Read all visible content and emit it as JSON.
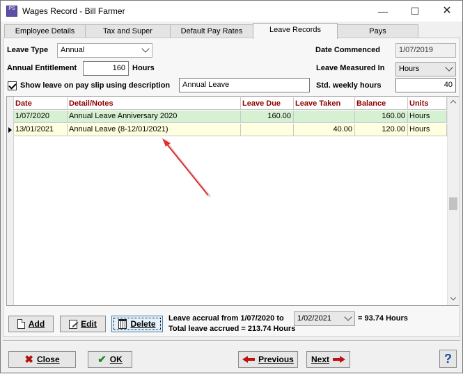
{
  "window": {
    "app_icon_text": "PS",
    "title": "Wages Record - Bill Farmer",
    "minimize": "—",
    "maximize": "☐",
    "close": "✕"
  },
  "tabs": [
    {
      "label": "Employee Details",
      "active": false
    },
    {
      "label": "Tax and Super",
      "active": false
    },
    {
      "label": "Default Pay Rates",
      "active": false
    },
    {
      "label": "Leave Records",
      "active": true
    },
    {
      "label": "Pays",
      "active": false
    }
  ],
  "form": {
    "leave_type_label": "Leave Type",
    "leave_type_value": "Annual",
    "date_commenced_label": "Date Commenced",
    "date_commenced_value": "1/07/2019",
    "annual_entitlement_label": "Annual Entitlement",
    "annual_entitlement_value": "160",
    "annual_entitlement_unit": "Hours",
    "leave_measured_label": "Leave Measured In",
    "leave_measured_value": "Hours",
    "show_leave_label": "Show leave on pay slip using description",
    "show_leave_checked": true,
    "show_leave_description": "Annual Leave",
    "std_weekly_label": "Std. weekly hours",
    "std_weekly_value": "40"
  },
  "grid": {
    "columns": [
      "Date",
      "Detail/Notes",
      "Leave Due",
      "Leave Taken",
      "Balance",
      "Units"
    ],
    "rows": [
      {
        "date": "1/07/2020",
        "detail": "Annual Leave Anniversary 2020",
        "due": "160.00",
        "taken": "",
        "balance": "160.00",
        "units": "Hours"
      },
      {
        "date": "13/01/2021",
        "detail": "Annual Leave (8-12/01/2021)",
        "due": "",
        "taken": "40.00",
        "balance": "120.00",
        "units": "Hours"
      }
    ]
  },
  "actions": {
    "add": "Add",
    "edit": "Edit",
    "delete": "Delete",
    "accrual_prefix": "Leave accrual from 1/07/2020 to",
    "accrual_to_date": "1/02/2021",
    "accrual_result": "= 93.74 Hours",
    "total_accrued": "Total leave accrued = 213.74 Hours"
  },
  "footer": {
    "close": "Close",
    "ok": "OK",
    "previous": "Previous",
    "next": "Next",
    "help": "?"
  },
  "colors": {
    "row_green": "#d6f0d2",
    "row_yellow": "#ffffe0",
    "header_text": "#8b0000",
    "annotation_arrow": "#e03030"
  }
}
